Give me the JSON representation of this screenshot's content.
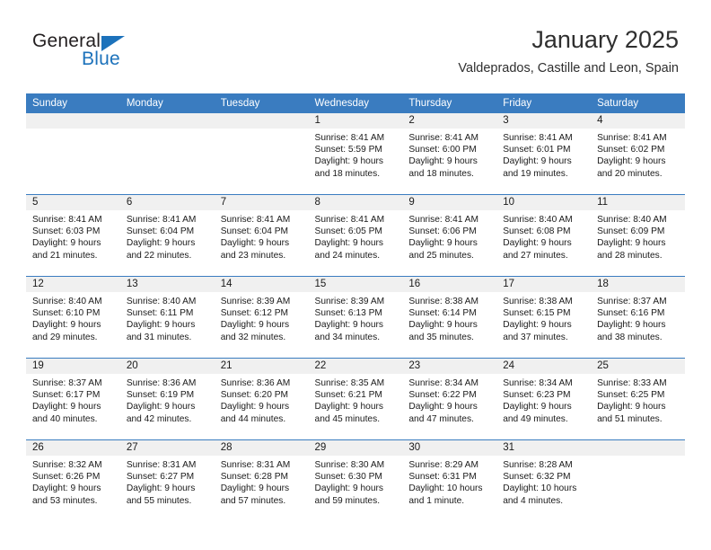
{
  "brand": {
    "line1": "General",
    "line2": "Blue",
    "accent_color": "#1c72bb",
    "triangle_icon": "brand-triangle-icon"
  },
  "header": {
    "title": "January 2025",
    "subtitle": "Valdeprados, Castille and Leon, Spain"
  },
  "calendar": {
    "header_bg": "#3a7cc0",
    "daynum_bg": "#f0f0f0",
    "weekdays": [
      "Sunday",
      "Monday",
      "Tuesday",
      "Wednesday",
      "Thursday",
      "Friday",
      "Saturday"
    ],
    "weeks": [
      [
        {
          "day": "",
          "sunrise": "",
          "sunset": "",
          "daylight1": "",
          "daylight2": ""
        },
        {
          "day": "",
          "sunrise": "",
          "sunset": "",
          "daylight1": "",
          "daylight2": ""
        },
        {
          "day": "",
          "sunrise": "",
          "sunset": "",
          "daylight1": "",
          "daylight2": ""
        },
        {
          "day": "1",
          "sunrise": "Sunrise: 8:41 AM",
          "sunset": "Sunset: 5:59 PM",
          "daylight1": "Daylight: 9 hours",
          "daylight2": "and 18 minutes."
        },
        {
          "day": "2",
          "sunrise": "Sunrise: 8:41 AM",
          "sunset": "Sunset: 6:00 PM",
          "daylight1": "Daylight: 9 hours",
          "daylight2": "and 18 minutes."
        },
        {
          "day": "3",
          "sunrise": "Sunrise: 8:41 AM",
          "sunset": "Sunset: 6:01 PM",
          "daylight1": "Daylight: 9 hours",
          "daylight2": "and 19 minutes."
        },
        {
          "day": "4",
          "sunrise": "Sunrise: 8:41 AM",
          "sunset": "Sunset: 6:02 PM",
          "daylight1": "Daylight: 9 hours",
          "daylight2": "and 20 minutes."
        }
      ],
      [
        {
          "day": "5",
          "sunrise": "Sunrise: 8:41 AM",
          "sunset": "Sunset: 6:03 PM",
          "daylight1": "Daylight: 9 hours",
          "daylight2": "and 21 minutes."
        },
        {
          "day": "6",
          "sunrise": "Sunrise: 8:41 AM",
          "sunset": "Sunset: 6:04 PM",
          "daylight1": "Daylight: 9 hours",
          "daylight2": "and 22 minutes."
        },
        {
          "day": "7",
          "sunrise": "Sunrise: 8:41 AM",
          "sunset": "Sunset: 6:04 PM",
          "daylight1": "Daylight: 9 hours",
          "daylight2": "and 23 minutes."
        },
        {
          "day": "8",
          "sunrise": "Sunrise: 8:41 AM",
          "sunset": "Sunset: 6:05 PM",
          "daylight1": "Daylight: 9 hours",
          "daylight2": "and 24 minutes."
        },
        {
          "day": "9",
          "sunrise": "Sunrise: 8:41 AM",
          "sunset": "Sunset: 6:06 PM",
          "daylight1": "Daylight: 9 hours",
          "daylight2": "and 25 minutes."
        },
        {
          "day": "10",
          "sunrise": "Sunrise: 8:40 AM",
          "sunset": "Sunset: 6:08 PM",
          "daylight1": "Daylight: 9 hours",
          "daylight2": "and 27 minutes."
        },
        {
          "day": "11",
          "sunrise": "Sunrise: 8:40 AM",
          "sunset": "Sunset: 6:09 PM",
          "daylight1": "Daylight: 9 hours",
          "daylight2": "and 28 minutes."
        }
      ],
      [
        {
          "day": "12",
          "sunrise": "Sunrise: 8:40 AM",
          "sunset": "Sunset: 6:10 PM",
          "daylight1": "Daylight: 9 hours",
          "daylight2": "and 29 minutes."
        },
        {
          "day": "13",
          "sunrise": "Sunrise: 8:40 AM",
          "sunset": "Sunset: 6:11 PM",
          "daylight1": "Daylight: 9 hours",
          "daylight2": "and 31 minutes."
        },
        {
          "day": "14",
          "sunrise": "Sunrise: 8:39 AM",
          "sunset": "Sunset: 6:12 PM",
          "daylight1": "Daylight: 9 hours",
          "daylight2": "and 32 minutes."
        },
        {
          "day": "15",
          "sunrise": "Sunrise: 8:39 AM",
          "sunset": "Sunset: 6:13 PM",
          "daylight1": "Daylight: 9 hours",
          "daylight2": "and 34 minutes."
        },
        {
          "day": "16",
          "sunrise": "Sunrise: 8:38 AM",
          "sunset": "Sunset: 6:14 PM",
          "daylight1": "Daylight: 9 hours",
          "daylight2": "and 35 minutes."
        },
        {
          "day": "17",
          "sunrise": "Sunrise: 8:38 AM",
          "sunset": "Sunset: 6:15 PM",
          "daylight1": "Daylight: 9 hours",
          "daylight2": "and 37 minutes."
        },
        {
          "day": "18",
          "sunrise": "Sunrise: 8:37 AM",
          "sunset": "Sunset: 6:16 PM",
          "daylight1": "Daylight: 9 hours",
          "daylight2": "and 38 minutes."
        }
      ],
      [
        {
          "day": "19",
          "sunrise": "Sunrise: 8:37 AM",
          "sunset": "Sunset: 6:17 PM",
          "daylight1": "Daylight: 9 hours",
          "daylight2": "and 40 minutes."
        },
        {
          "day": "20",
          "sunrise": "Sunrise: 8:36 AM",
          "sunset": "Sunset: 6:19 PM",
          "daylight1": "Daylight: 9 hours",
          "daylight2": "and 42 minutes."
        },
        {
          "day": "21",
          "sunrise": "Sunrise: 8:36 AM",
          "sunset": "Sunset: 6:20 PM",
          "daylight1": "Daylight: 9 hours",
          "daylight2": "and 44 minutes."
        },
        {
          "day": "22",
          "sunrise": "Sunrise: 8:35 AM",
          "sunset": "Sunset: 6:21 PM",
          "daylight1": "Daylight: 9 hours",
          "daylight2": "and 45 minutes."
        },
        {
          "day": "23",
          "sunrise": "Sunrise: 8:34 AM",
          "sunset": "Sunset: 6:22 PM",
          "daylight1": "Daylight: 9 hours",
          "daylight2": "and 47 minutes."
        },
        {
          "day": "24",
          "sunrise": "Sunrise: 8:34 AM",
          "sunset": "Sunset: 6:23 PM",
          "daylight1": "Daylight: 9 hours",
          "daylight2": "and 49 minutes."
        },
        {
          "day": "25",
          "sunrise": "Sunrise: 8:33 AM",
          "sunset": "Sunset: 6:25 PM",
          "daylight1": "Daylight: 9 hours",
          "daylight2": "and 51 minutes."
        }
      ],
      [
        {
          "day": "26",
          "sunrise": "Sunrise: 8:32 AM",
          "sunset": "Sunset: 6:26 PM",
          "daylight1": "Daylight: 9 hours",
          "daylight2": "and 53 minutes."
        },
        {
          "day": "27",
          "sunrise": "Sunrise: 8:31 AM",
          "sunset": "Sunset: 6:27 PM",
          "daylight1": "Daylight: 9 hours",
          "daylight2": "and 55 minutes."
        },
        {
          "day": "28",
          "sunrise": "Sunrise: 8:31 AM",
          "sunset": "Sunset: 6:28 PM",
          "daylight1": "Daylight: 9 hours",
          "daylight2": "and 57 minutes."
        },
        {
          "day": "29",
          "sunrise": "Sunrise: 8:30 AM",
          "sunset": "Sunset: 6:30 PM",
          "daylight1": "Daylight: 9 hours",
          "daylight2": "and 59 minutes."
        },
        {
          "day": "30",
          "sunrise": "Sunrise: 8:29 AM",
          "sunset": "Sunset: 6:31 PM",
          "daylight1": "Daylight: 10 hours",
          "daylight2": "and 1 minute."
        },
        {
          "day": "31",
          "sunrise": "Sunrise: 8:28 AM",
          "sunset": "Sunset: 6:32 PM",
          "daylight1": "Daylight: 10 hours",
          "daylight2": "and 4 minutes."
        },
        {
          "day": "",
          "sunrise": "",
          "sunset": "",
          "daylight1": "",
          "daylight2": ""
        }
      ]
    ]
  }
}
